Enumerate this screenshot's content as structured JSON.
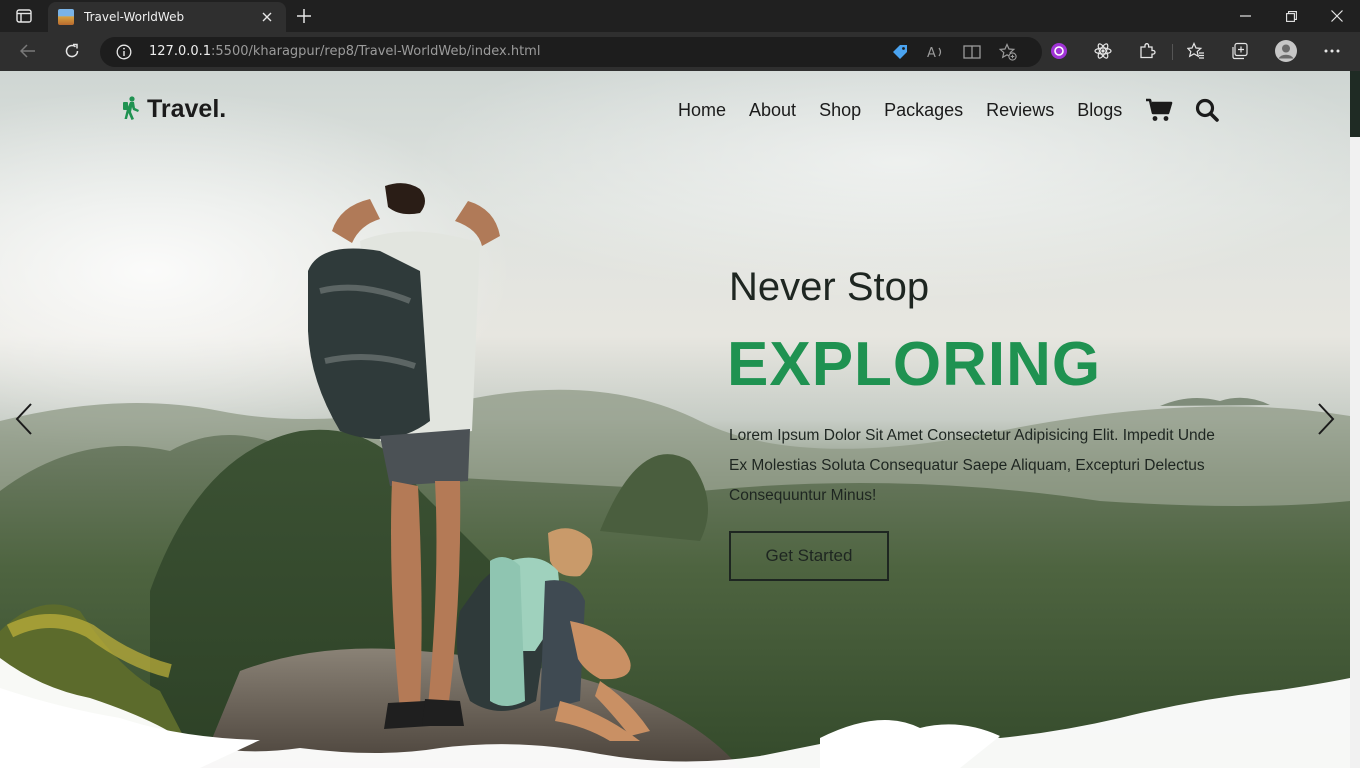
{
  "browser": {
    "tab_title": "Travel-WorldWeb",
    "url_host": "127.0.0.1",
    "url_rest": ":5500/kharagpur/rep8/Travel-WorldWeb/index.html"
  },
  "icons": {
    "tab_actions": "tab-actions-icon",
    "close": "close-icon",
    "new_tab": "plus-icon",
    "minimize": "minimize-icon",
    "restore": "restore-icon",
    "window_close": "close-icon",
    "back": "back-arrow-icon",
    "refresh": "refresh-icon",
    "info": "info-icon",
    "tag": "tag-icon",
    "read_aloud": "read-aloud-icon",
    "reader": "immersive-reader-icon",
    "add_favorite": "add-favorite-icon",
    "extension_purple": "extension-icon",
    "react_devtools": "react-icon",
    "extensions": "puzzle-icon",
    "favorites": "favorites-icon",
    "collections": "collections-icon",
    "profile": "profile-icon",
    "more": "more-icon",
    "logo": "hiker-icon",
    "cart": "cart-icon",
    "search": "search-icon",
    "prev": "chevron-left-icon",
    "next": "chevron-right-icon"
  },
  "site": {
    "logo_text": "Travel.",
    "nav": [
      "Home",
      "About",
      "Shop",
      "Packages",
      "Reviews",
      "Blogs"
    ],
    "hero": {
      "pre_title": "Never Stop",
      "title": "EXPLORING",
      "description": "Lorem Ipsum Dolor Sit Amet Consectetur Adipisicing Elit. Impedit Unde Ex Molestias Soluta Consequatur Saepe Aliquam, Excepturi Delectus Consequuntur Minus!",
      "cta": "Get Started"
    }
  },
  "colors": {
    "accent": "#1f9251",
    "text_dark": "#1e2621",
    "chrome_bg": "#202020",
    "toolbar_bg": "#2f2f2f"
  }
}
